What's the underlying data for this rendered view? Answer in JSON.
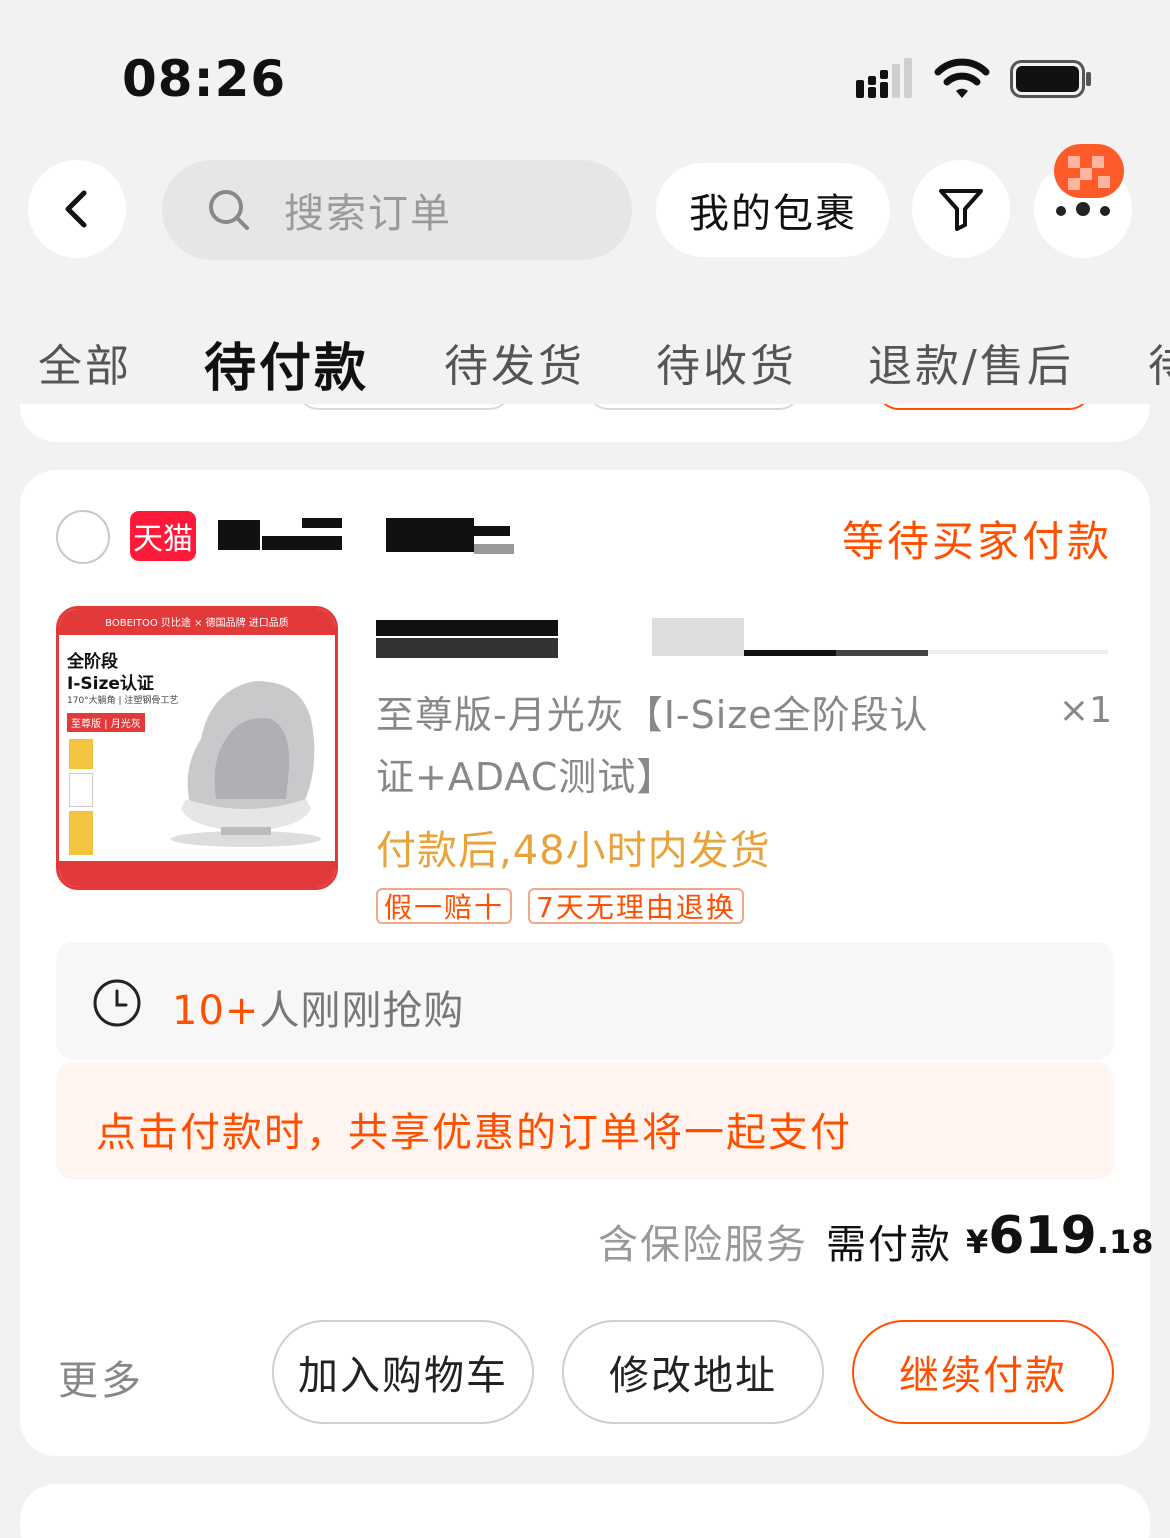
{
  "status_bar": {
    "time": "08:26"
  },
  "header": {
    "search_placeholder": "搜索订单",
    "packages_label": "我的包裹"
  },
  "tabs": [
    {
      "label": "全部",
      "active": false
    },
    {
      "label": "待付款",
      "active": true
    },
    {
      "label": "待发货",
      "active": false
    },
    {
      "label": "待收货",
      "active": false
    },
    {
      "label": "退款/售后",
      "active": false
    },
    {
      "label": "待",
      "active": false
    }
  ],
  "order": {
    "platform_badge": "天猫",
    "status": "等待买家付款",
    "product": {
      "image_texts": {
        "brand_band": "BOBEITOO 贝比途  ×  德国品牌  进口品质",
        "headline1": "全阶段",
        "headline2": "I-Size认证",
        "subline": "170°大躺角 | 注塑钢骨工艺",
        "edition_tag": "至尊版 | 月光灰"
      },
      "sku": "至尊版-月光灰【I-Size全阶段认证+ADAC测试】",
      "quantity": "×1",
      "shipping_note": "付款后,48小时内发货",
      "tags": [
        "假一赔十",
        "7天无理由退换"
      ]
    },
    "hot_count": "10+",
    "hot_text": "人刚刚抢购",
    "notice": "点击付款时，共享优惠的订单将一起支付",
    "insurance_label": "含保险服务",
    "need_pay_label": "需付款",
    "price": {
      "currency": "¥",
      "integer": "619",
      "decimal": ".18"
    },
    "more_label": "更多",
    "actions": {
      "add_cart": "加入购物车",
      "change_address": "修改地址",
      "continue_pay": "继续付款"
    }
  },
  "colors": {
    "accent": "#ff5000",
    "tmall": "#ff1a3a",
    "shipping": "#e8a33a",
    "background": "#f2f2f2"
  },
  "icons": [
    "back-icon",
    "search-icon",
    "filter-icon",
    "more-dots-icon",
    "clock-icon",
    "signal-icon",
    "wifi-icon",
    "battery-icon"
  ]
}
